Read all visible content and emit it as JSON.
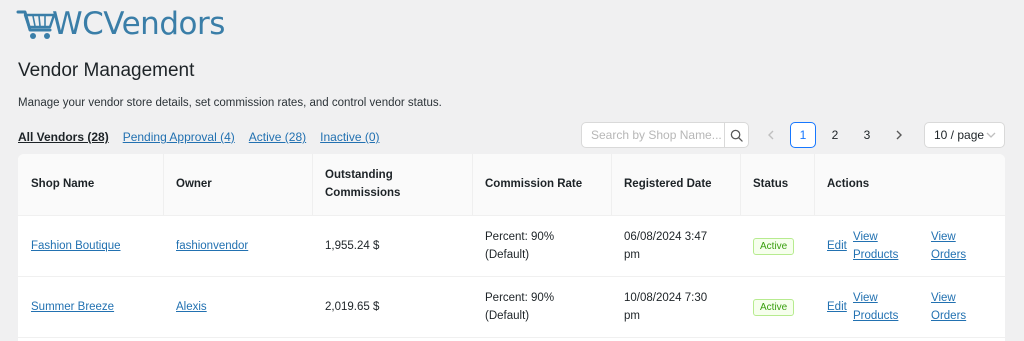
{
  "brand": {
    "logo_text": "WCVendors",
    "logo_color": "#3a7ea8"
  },
  "page": {
    "title": "Vendor Management",
    "description": "Manage your vendor store details, set commission rates, and control vendor status."
  },
  "filters": [
    {
      "label": "All Vendors (28)",
      "current": true
    },
    {
      "label": "Pending Approval (4)",
      "current": false
    },
    {
      "label": "Active (28)",
      "current": false
    },
    {
      "label": "Inactive (0)",
      "current": false
    }
  ],
  "search": {
    "placeholder": "Search by Shop Name...",
    "value": ""
  },
  "pagination": {
    "prev": "‹",
    "next": "›",
    "pages": [
      "1",
      "2",
      "3"
    ],
    "current_page": "1",
    "page_size": "10 / page"
  },
  "table": {
    "headers": {
      "shop_name": "Shop Name",
      "owner": "Owner",
      "outstanding_commissions_1": "Outstanding",
      "outstanding_commissions_2": "Commissions",
      "commission_rate": "Commission Rate",
      "registered_date": "Registered Date",
      "status": "Status",
      "actions": "Actions"
    },
    "rows": [
      {
        "shop_name": "Fashion Boutique",
        "owner": "fashionvendor",
        "outstanding": "1,955.24 $",
        "rate_line1": "Percent: 90%",
        "rate_line2": "(Default)",
        "date_line1": "06/08/2024 3:47",
        "date_line2": "pm",
        "status": "Active",
        "edit": "Edit",
        "view_products_1": "View",
        "view_products_2": "Products",
        "view_orders_1": "View",
        "view_orders_2": "Orders"
      },
      {
        "shop_name": "Summer Breeze",
        "owner": "Alexis",
        "outstanding": "2,019.65 $",
        "rate_line1": "Percent: 90%",
        "rate_line2": "(Default)",
        "date_line1": "10/08/2024 7:30",
        "date_line2": "pm",
        "status": "Active",
        "edit": "Edit",
        "view_products_1": "View",
        "view_products_2": "Products",
        "view_orders_1": "View",
        "view_orders_2": "Orders"
      }
    ]
  },
  "colors": {
    "link": "#2271b1",
    "accent": "#1677ff",
    "status_active": "#389e0d"
  },
  "icons": {
    "logo": "shopping-cart-icon",
    "search": "search-icon",
    "prev": "chevron-left-icon",
    "next": "chevron-right-icon",
    "dropdown": "chevron-down-icon"
  }
}
